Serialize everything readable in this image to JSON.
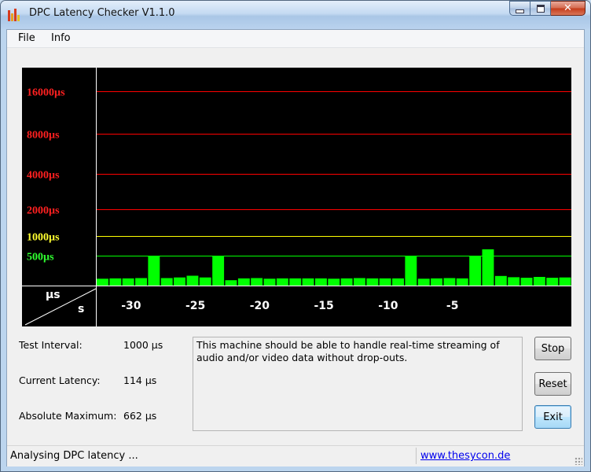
{
  "window": {
    "title": "DPC Latency Checker V1.1.0"
  },
  "menu": {
    "items": [
      "File",
      "Info"
    ]
  },
  "graph": {
    "y_labels": [
      {
        "text": "16000µs",
        "color": "#ff2020"
      },
      {
        "text": "8000µs",
        "color": "#ff2020"
      },
      {
        "text": "4000µs",
        "color": "#ff2020"
      },
      {
        "text": "2000µs",
        "color": "#ff2020"
      },
      {
        "text": "1000µs",
        "color": "#ffff30"
      },
      {
        "text": "500µs",
        "color": "#30ff30"
      }
    ],
    "corner_top": "µs",
    "corner_bottom": "s",
    "x_labels": [
      "-30",
      "-25",
      "-20",
      "-15",
      "-10",
      "-5"
    ]
  },
  "chart_data": {
    "type": "bar",
    "xlabel": "s",
    "ylabel": "µs",
    "y_tick_labels": [
      "500µs",
      "1000µs",
      "2000µs",
      "4000µs",
      "8000µs",
      "16000µs"
    ],
    "x_tick_labels": [
      "-30",
      "-25",
      "-20",
      "-15",
      "-10",
      "-5"
    ],
    "grid_colors": {
      "red": "#ff0000",
      "yellow": "#ffff00",
      "green": "#00ff00",
      "bar": "#00ff00"
    },
    "values": [
      114,
      120,
      120,
      125,
      500,
      125,
      135,
      165,
      135,
      500,
      90,
      120,
      125,
      115,
      120,
      120,
      120,
      120,
      115,
      120,
      125,
      120,
      120,
      120,
      500,
      115,
      120,
      125,
      120,
      500,
      662,
      160,
      140,
      130,
      145,
      130,
      135
    ]
  },
  "info": {
    "test_interval_label": "Test Interval:",
    "test_interval_value": "1000 µs",
    "current_latency_label": "Current Latency:",
    "current_latency_value": "114 µs",
    "absolute_maximum_label": "Absolute Maximum:",
    "absolute_maximum_value": "662 µs"
  },
  "message": "This machine should be able to handle real-time streaming of audio and/or video data without drop-outs.",
  "buttons": {
    "stop": "Stop",
    "reset": "Reset",
    "exit": "Exit"
  },
  "status": {
    "text": "Analysing DPC latency ...",
    "link": "www.thesycon.de"
  }
}
